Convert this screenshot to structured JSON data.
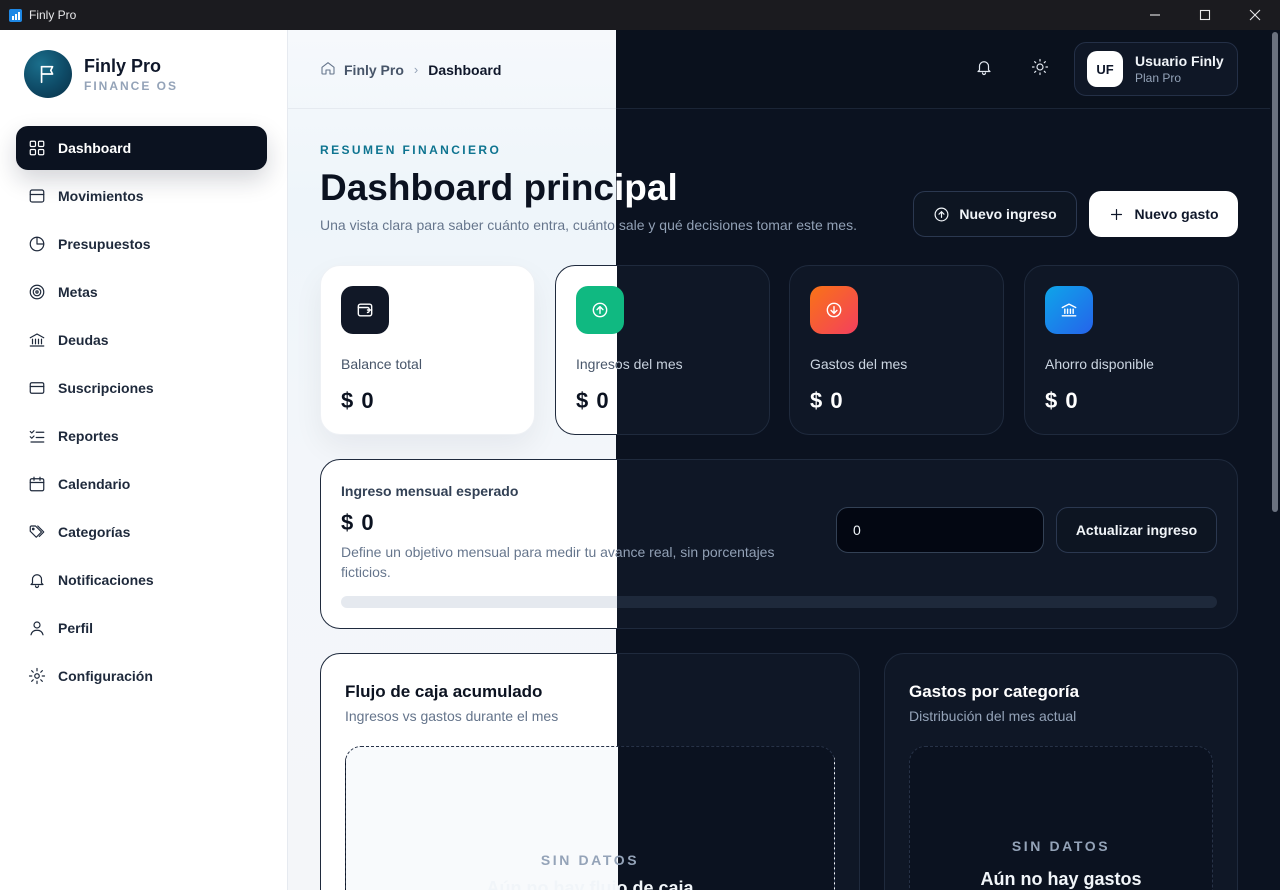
{
  "window": {
    "title": "Finly Pro"
  },
  "brand": {
    "name": "Finly Pro",
    "subtitle": "FINANCE OS"
  },
  "sidebar": {
    "items": [
      {
        "label": "Dashboard",
        "icon": "dashboard-icon",
        "active": true
      },
      {
        "label": "Movimientos",
        "icon": "wallet-icon"
      },
      {
        "label": "Presupuestos",
        "icon": "pie-chart-icon"
      },
      {
        "label": "Metas",
        "icon": "target-icon"
      },
      {
        "label": "Deudas",
        "icon": "bank-icon"
      },
      {
        "label": "Suscripciones",
        "icon": "credit-card-icon"
      },
      {
        "label": "Reportes",
        "icon": "checklist-icon"
      },
      {
        "label": "Calendario",
        "icon": "calendar-icon"
      },
      {
        "label": "Categorías",
        "icon": "tags-icon"
      },
      {
        "label": "Notificaciones",
        "icon": "bell-icon"
      },
      {
        "label": "Perfil",
        "icon": "user-icon"
      },
      {
        "label": "Configuración",
        "icon": "gear-icon"
      }
    ]
  },
  "header": {
    "breadcrumb": [
      "Finly Pro",
      "Dashboard"
    ],
    "user": {
      "initials": "UF",
      "name": "Usuario Finly",
      "plan": "Plan Pro"
    }
  },
  "hero": {
    "eyebrow": "RESUMEN FINANCIERO",
    "title": "Dashboard principal",
    "subtitle": "Una vista clara para saber cuánto entra, cuánto sale y qué decisiones tomar este mes.",
    "actions": {
      "income": "Nuevo ingreso",
      "expense": "Nuevo gasto"
    }
  },
  "stats": [
    {
      "label": "Balance total",
      "value": "$ 0",
      "icon": "wallet-icon",
      "color": "#111827"
    },
    {
      "label": "Ingresos del mes",
      "value": "$ 0",
      "icon": "arrow-up-circle-icon",
      "color": "#10b981"
    },
    {
      "label": "Gastos del mes",
      "value": "$ 0",
      "icon": "arrow-down-circle-icon",
      "color": "#f43f5e"
    },
    {
      "label": "Ahorro disponible",
      "value": "$ 0",
      "icon": "bank-icon",
      "color": "#0ea5e9"
    }
  ],
  "income_goal": {
    "label": "Ingreso mensual esperado",
    "value": "$ 0",
    "description": "Define un objetivo mensual para medir tu avance real, sin porcentajes ficticios.",
    "input_value": "0",
    "button": "Actualizar ingreso",
    "progress": 0
  },
  "panels": {
    "cash_flow": {
      "title": "Flujo de caja acumulado",
      "subtitle": "Ingresos vs gastos durante el mes",
      "empty_tag": "SIN DATOS",
      "empty_msg": "Aún no hay flujo de caja"
    },
    "categories": {
      "title": "Gastos por categoría",
      "subtitle": "Distribución del mes actual",
      "empty_tag": "SIN DATOS",
      "empty_msg": "Aún no hay gastos"
    }
  },
  "colors": {
    "accent": "#0e7490",
    "dark": "#0b1220",
    "income": "#10b981",
    "expense": "#f43f5e",
    "savings": "#0ea5e9"
  }
}
